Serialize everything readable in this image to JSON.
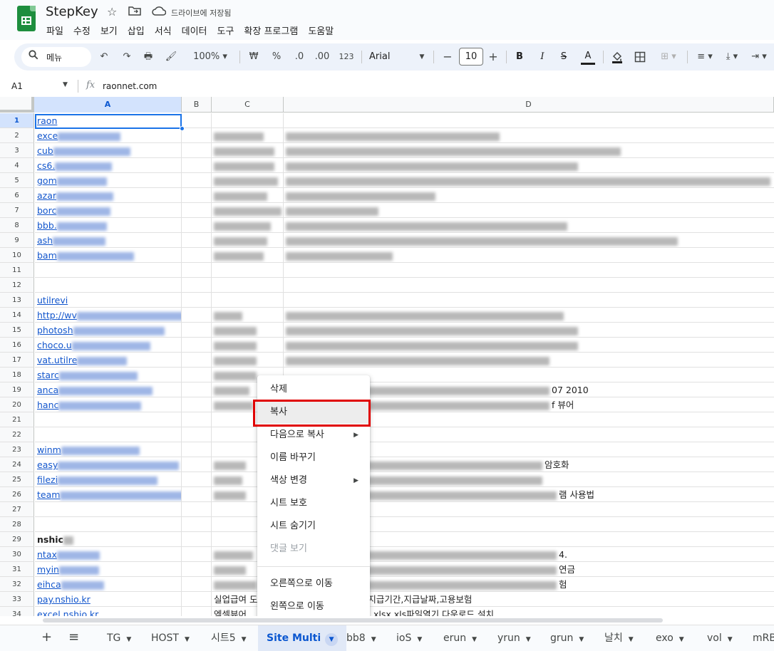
{
  "app": {
    "doc_title": "StepKey",
    "save_status": "드라이브에 저장됨",
    "menu": [
      "파일",
      "수정",
      "보기",
      "삽입",
      "서식",
      "데이터",
      "도구",
      "확장 프로그램",
      "도움말"
    ]
  },
  "toolbar": {
    "search_label": "메뉴",
    "zoom": "100%",
    "currency": "₩",
    "percent": "%",
    "dec_decrease": ".0",
    "dec_increase": ".00",
    "format_123": "123",
    "font_family": "Arial",
    "font_size": "10",
    "minus": "−",
    "plus": "+",
    "bold": "B",
    "italic": "I",
    "strike": "S",
    "text_color": "A",
    "accent_color": "#1a73e8"
  },
  "formula_bar": {
    "cell_ref": "A1",
    "fx": "fx",
    "value": "raonnet.com"
  },
  "columns": [
    "A",
    "B",
    "C",
    "D"
  ],
  "rows": [
    {
      "n": "1",
      "a": "raon",
      "c": "",
      "d": ""
    },
    {
      "n": "2",
      "a": "exce",
      "c": "",
      "d": ""
    },
    {
      "n": "3",
      "a": "cub",
      "c": "",
      "d": ""
    },
    {
      "n": "4",
      "a": "cs6.",
      "c": "",
      "d": ""
    },
    {
      "n": "5",
      "a": "gom",
      "c": "",
      "d": ""
    },
    {
      "n": "6",
      "a": "azar",
      "c": "",
      "d": ""
    },
    {
      "n": "7",
      "a": "borc",
      "c": "",
      "d": ""
    },
    {
      "n": "8",
      "a": "bbb.",
      "c": "",
      "d": ""
    },
    {
      "n": "9",
      "a": "ash",
      "c": "",
      "d": ""
    },
    {
      "n": "10",
      "a": "bam",
      "c": "",
      "d": ""
    },
    {
      "n": "11",
      "a": "",
      "c": "",
      "d": ""
    },
    {
      "n": "12",
      "a": "",
      "c": "",
      "d": ""
    },
    {
      "n": "13",
      "a": "utilrevi",
      "c": "",
      "d": ""
    },
    {
      "n": "14",
      "a": "http://wv",
      "c": "",
      "d": ""
    },
    {
      "n": "15",
      "a": "photosh",
      "c": "",
      "d": ""
    },
    {
      "n": "16",
      "a": "choco.u",
      "c": "",
      "d": ""
    },
    {
      "n": "17",
      "a": "vat.utilre",
      "c": "",
      "d": ""
    },
    {
      "n": "18",
      "a": "starc",
      "c": "",
      "d": ""
    },
    {
      "n": "19",
      "a": "anca",
      "c": "",
      "d": "07 2010"
    },
    {
      "n": "20",
      "a": "hanc",
      "c": "",
      "d": "f 뷰어"
    },
    {
      "n": "21",
      "a": "",
      "c": "",
      "d": ""
    },
    {
      "n": "22",
      "a": "",
      "c": "",
      "d": ""
    },
    {
      "n": "23",
      "a": "winm",
      "c": "",
      "d": ""
    },
    {
      "n": "24",
      "a": "easy",
      "c": "",
      "d": "암호화"
    },
    {
      "n": "25",
      "a": "filezi",
      "c": "",
      "d": ""
    },
    {
      "n": "26",
      "a": "team",
      "c": "",
      "d": "램 사용법"
    },
    {
      "n": "27",
      "a": "",
      "c": "",
      "d": ""
    },
    {
      "n": "28",
      "a": "",
      "c": "",
      "d": ""
    },
    {
      "n": "29",
      "a": "nshic",
      "c": "",
      "d": ""
    },
    {
      "n": "30",
      "a": "ntax",
      "c": "",
      "d": "4."
    },
    {
      "n": "31",
      "a": "myin",
      "c": "",
      "d": "연금"
    },
    {
      "n": "32",
      "a": "eihca",
      "c": "",
      "d": "험"
    },
    {
      "n": "33",
      "a": "pay.nshio.kr",
      "c": "실업급여 도",
      "d": "산기,계산법,신청방법,지급기간,지급날짜,고용보험"
    },
    {
      "n": "34",
      "a": "excel.nshio.kr",
      "c": "엑셀뷰어",
      "d": "마이크로소프트 오피스 xlsx xls파일열기 다운로드 설치"
    }
  ],
  "context_menu": {
    "items": [
      {
        "label": "삭제"
      },
      {
        "label": "복사"
      },
      {
        "label": "다음으로 복사",
        "submenu": true
      },
      {
        "label": "이름 바꾸기"
      },
      {
        "label": "색상 변경",
        "submenu": true
      },
      {
        "label": "시트 보호"
      },
      {
        "label": "시트 숨기기"
      },
      {
        "label": "댓글 보기",
        "disabled": true
      },
      {
        "label": "오른쪽으로 이동"
      },
      {
        "label": "왼쪽으로 이동"
      }
    ],
    "highlight_color": "#e00000"
  },
  "sheet_tabs": {
    "add": "+",
    "list": "≡",
    "tabs": [
      "TG",
      "HOST",
      "시트5",
      "Site Multi",
      "bb8",
      "ioS",
      "erun",
      "yrun",
      "grun",
      "날치",
      "exo",
      "vol",
      "mRB"
    ],
    "active": "Site Multi"
  }
}
